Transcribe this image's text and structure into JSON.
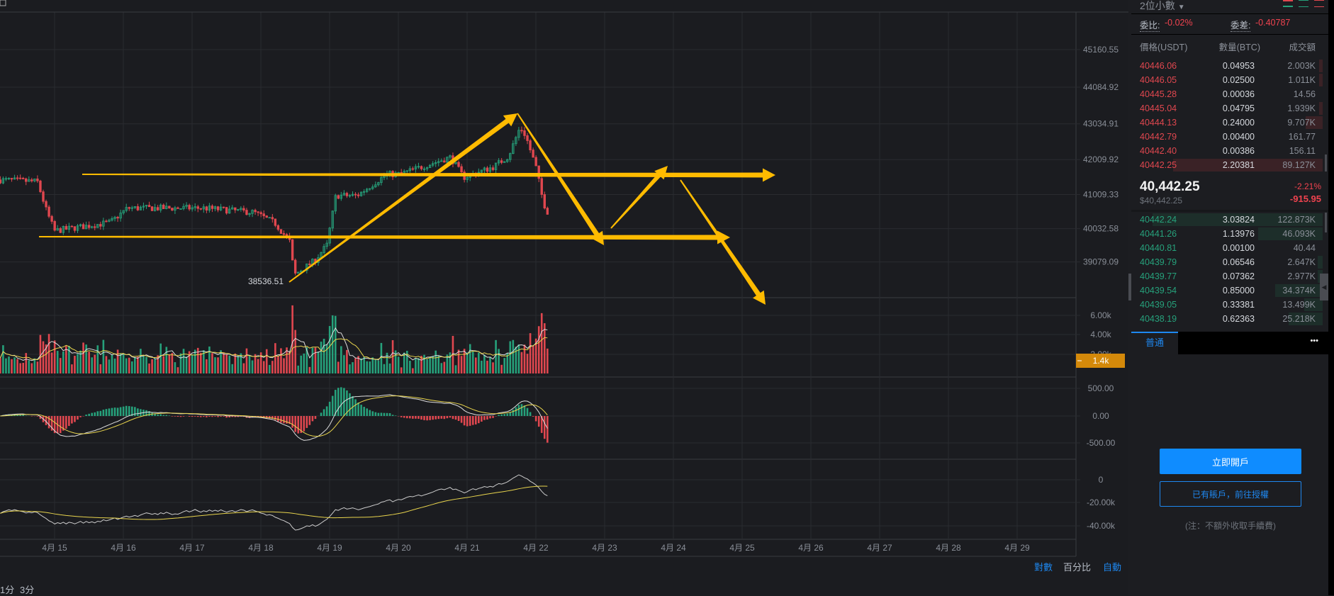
{
  "chart": {
    "price_axis": [
      "45160.55",
      "44084.92",
      "43034.91",
      "42009.92",
      "41009.33",
      "40032.58",
      "39079.09"
    ],
    "volume_axis": [
      "6.00k",
      "4.00k",
      "2.00k"
    ],
    "volume_badge": "1.4k",
    "macd_axis": [
      "500.00",
      "0.00",
      "-500.00"
    ],
    "third_axis": [
      "0",
      "-20.00k",
      "-40.00k"
    ],
    "dates": [
      "4月 15",
      "4月 16",
      "4月 17",
      "4月 18",
      "4月 19",
      "4月 20",
      "4月 21",
      "4月 22",
      "4月 23",
      "4月 24",
      "4月 25",
      "4月 26",
      "4月 27",
      "4月 28",
      "4月 29"
    ],
    "low_label": "38536.51",
    "price_path": [
      [
        -0.79,
        41430
      ],
      [
        -0.25,
        41380
      ],
      [
        -0.11,
        40495
      ],
      [
        0.0,
        39970
      ],
      [
        0.81,
        40210
      ],
      [
        1.06,
        40620
      ],
      [
        2.17,
        40620
      ],
      [
        2.9,
        40500
      ],
      [
        3.2,
        40200
      ],
      [
        3.43,
        39640
      ],
      [
        3.48,
        38700
      ],
      [
        3.78,
        39110
      ],
      [
        3.96,
        39560
      ],
      [
        4.09,
        40980
      ],
      [
        4.4,
        40980
      ],
      [
        4.83,
        41590
      ],
      [
        5.02,
        41590
      ],
      [
        5.76,
        42080
      ],
      [
        5.95,
        41500
      ],
      [
        6.38,
        41800
      ],
      [
        6.6,
        42100
      ],
      [
        6.77,
        42930
      ],
      [
        6.85,
        42700
      ],
      [
        7.0,
        41800
      ],
      [
        7.1,
        40860
      ],
      [
        7.17,
        40442
      ]
    ],
    "colors": {
      "up": "#26a17b",
      "down": "#e0474f",
      "annotation": "#ffbb00",
      "badge": "#d4890a"
    }
  },
  "bottom_bar": {
    "log": "對數",
    "percent": "百分比",
    "auto": "自動"
  },
  "timeframes": [
    "1分",
    "3分"
  ],
  "panel": {
    "decimals": "2位小數",
    "ratio_label": "委比:",
    "ratio_value": "-0.02%",
    "diff_label": "委差:",
    "diff_value": "-0.40787",
    "headers": {
      "price": "價格(USDT)",
      "amount": "數量(BTC)",
      "total": "成交額"
    },
    "asks": [
      {
        "price": "40446.06",
        "amount": "0.04953",
        "total": "2.003K",
        "depth": 0.02
      },
      {
        "price": "40446.05",
        "amount": "0.02500",
        "total": "1.011K",
        "depth": 0.02
      },
      {
        "price": "40445.28",
        "amount": "0.00036",
        "total": "14.56",
        "depth": 0
      },
      {
        "price": "40445.04",
        "amount": "0.04795",
        "total": "1.939K",
        "depth": 0.02
      },
      {
        "price": "40444.13",
        "amount": "0.24000",
        "total": "9.707K",
        "depth": 0.1
      },
      {
        "price": "40442.79",
        "amount": "0.00400",
        "total": "161.77",
        "depth": 0
      },
      {
        "price": "40442.40",
        "amount": "0.00386",
        "total": "156.11",
        "depth": 0
      },
      {
        "price": "40442.25",
        "amount": "2.20381",
        "total": "89.127K",
        "depth": 0.88
      }
    ],
    "last_price": "40,442.25",
    "last_price_usd": "$40,442.25",
    "change_pct": "-2.21%",
    "change_abs": "-915.95",
    "bids": [
      {
        "price": "40442.24",
        "amount": "3.03824",
        "total": "122.873K",
        "depth": 1.0
      },
      {
        "price": "40441.26",
        "amount": "1.13976",
        "total": "46.093K",
        "depth": 0.38
      },
      {
        "price": "40440.81",
        "amount": "0.00100",
        "total": "40.44",
        "depth": 0
      },
      {
        "price": "40439.79",
        "amount": "0.06546",
        "total": "2.647K",
        "depth": 0.03
      },
      {
        "price": "40439.77",
        "amount": "0.07362",
        "total": "2.977K",
        "depth": 0.03
      },
      {
        "price": "40439.54",
        "amount": "0.85000",
        "total": "34.374K",
        "depth": 0.28
      },
      {
        "price": "40439.05",
        "amount": "0.33381",
        "total": "13.499K",
        "depth": 0.11
      },
      {
        "price": "40438.19",
        "amount": "0.62363",
        "total": "25.218K",
        "depth": 0.2
      }
    ],
    "tab": "普通",
    "more": "•••",
    "open_account": "立即開戶",
    "authorize": "已有賬戶，前往授權",
    "note": "(注：不額外收取手續費)"
  }
}
